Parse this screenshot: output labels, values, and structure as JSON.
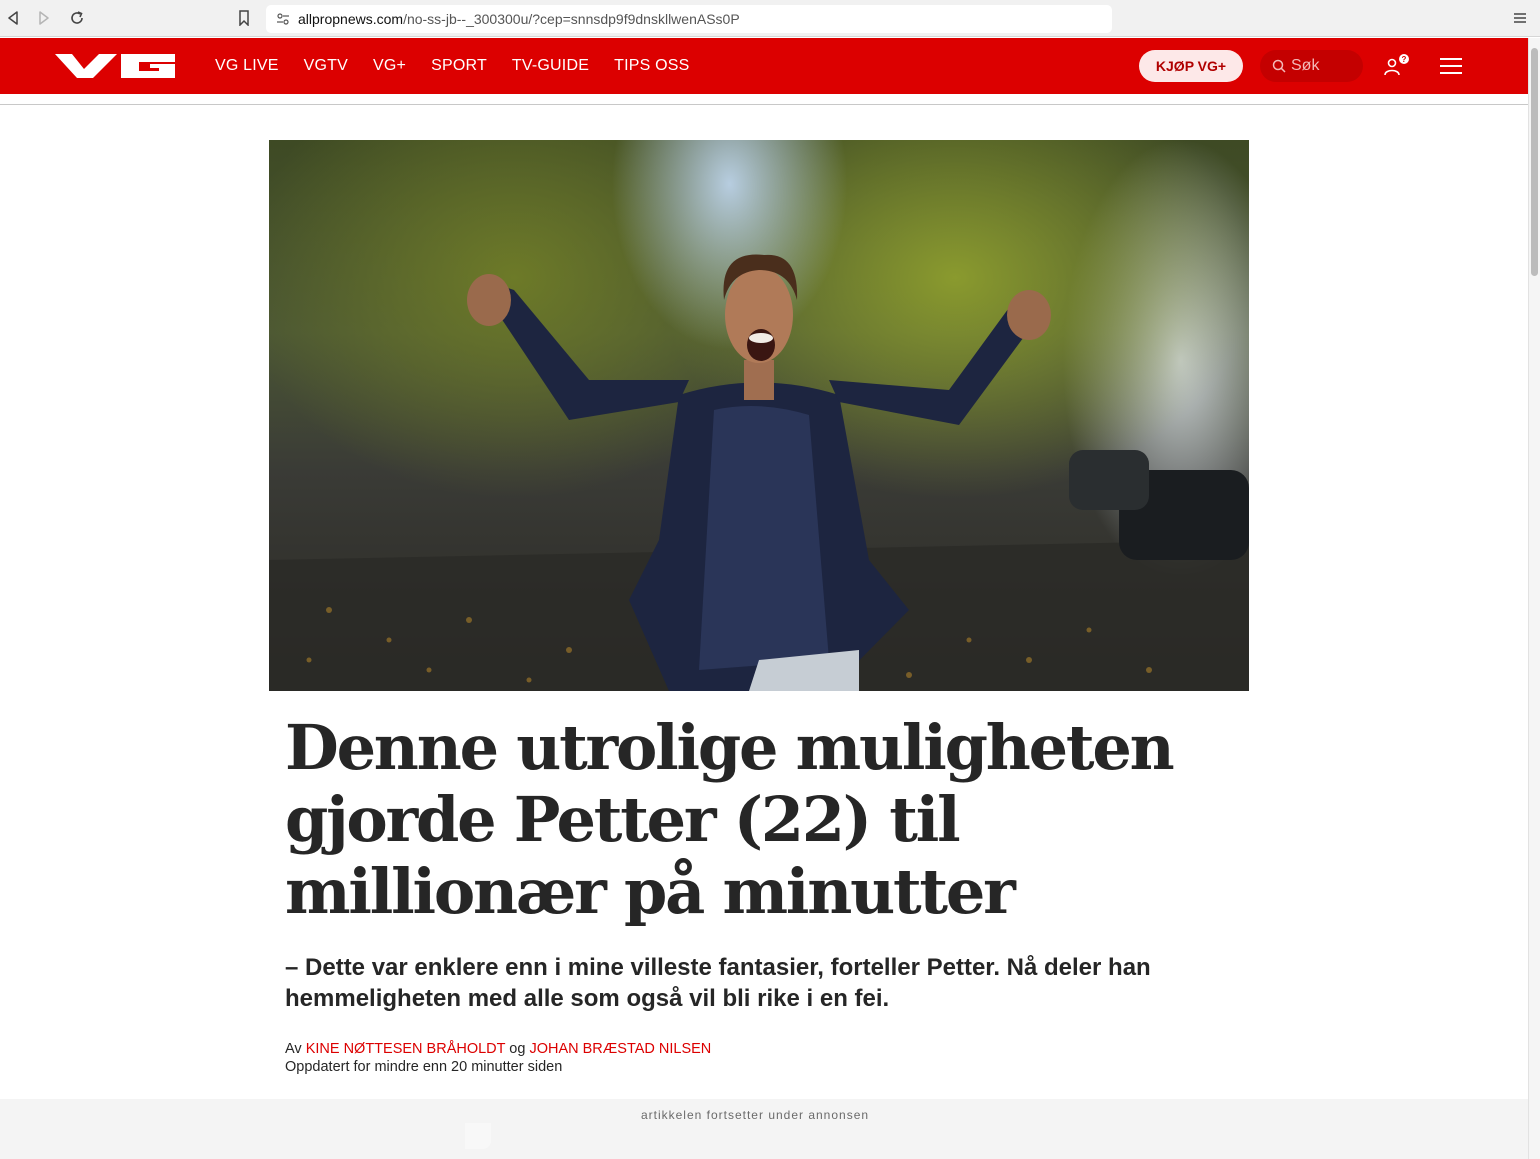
{
  "browser": {
    "url_domain": "allpropnews.com",
    "url_path": "/no-ss-jb--_300300u/?cep=snnsdp9f9dnskllwenASs0P",
    "icons": [
      "back-icon",
      "forward-icon",
      "reload-icon",
      "bookmark-icon",
      "site-settings-icon",
      "browser-menu-icon"
    ]
  },
  "header": {
    "brand": "VG",
    "brand_color": "#dc0000",
    "nav": [
      {
        "label": "VG LIVE"
      },
      {
        "label": "VGTV"
      },
      {
        "label": "VG+"
      },
      {
        "label": "SPORT"
      },
      {
        "label": "TV-GUIDE"
      },
      {
        "label": "TIPS OSS"
      }
    ],
    "buy_button": "KJØP VG+",
    "search_placeholder": "Søk"
  },
  "article": {
    "hero_alt": "Jublende ung mann med hevede armer i en løvrik gate",
    "headline": "Denne utrolige muligheten gjorde Petter (22) til millionær på minutter",
    "lead": "– Dette var enklere enn i mine villeste fantasier, forteller Petter. Nå deler han hemmeligheten med alle som også vil bli rike i en fei.",
    "byline_prefix": "Av",
    "author_1": "KINE NØTTESEN BRÅHOLDT",
    "byline_joiner": "og",
    "author_2": "JOHAN BRÆSTAD NILSEN",
    "updated": "Oppdatert for mindre enn 20 minutter siden"
  },
  "ad": {
    "label": "artikkelen fortsetter under annonsen"
  }
}
